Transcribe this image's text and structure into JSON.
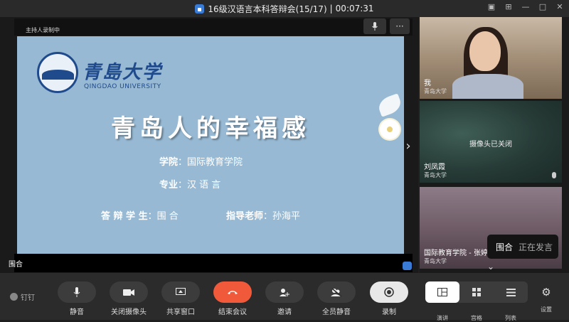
{
  "window": {
    "title": "16级汉语言本科答辩会(15/17)",
    "timer": "00:07:31"
  },
  "main": {
    "host_label": "主持人录制中",
    "more_label": "···",
    "speaker_name": "围合"
  },
  "slide": {
    "logo_cn": "青島大学",
    "logo_en": "QINGDAO UNIVERSITY",
    "title": "青岛人的幸福感",
    "college_label": "学院",
    "college_value": "国际教育学院",
    "major_label": "专业",
    "major_value": "汉 语 言",
    "student_label": "答 辩 学 生",
    "student_value": "围 合",
    "advisor_label": "指导老师",
    "advisor_value": "孙海平"
  },
  "participants": [
    {
      "name": "我",
      "org": "青岛大学"
    },
    {
      "name": "刘凤霞",
      "org": "青岛大学",
      "status": "摄像头已关闭"
    },
    {
      "name": "国际教育学院 - 张婷",
      "org": "青岛大学"
    }
  ],
  "speaking": {
    "name": "围合",
    "status": "正在发言"
  },
  "toolbar": {
    "brand": "钉钉",
    "mute": "静音",
    "camera_off": "关闭摄像头",
    "share": "共享窗口",
    "end": "结束会议",
    "invite": "邀请",
    "mute_all": "全员静音",
    "record": "录制",
    "view_speaker": "演讲",
    "view_grid": "宫格",
    "view_list": "列表",
    "settings": "设置"
  },
  "colors": {
    "slide_bg": "#97b9d3",
    "end_button": "#f05a3a",
    "brand_blue": "#1f4a8c"
  }
}
